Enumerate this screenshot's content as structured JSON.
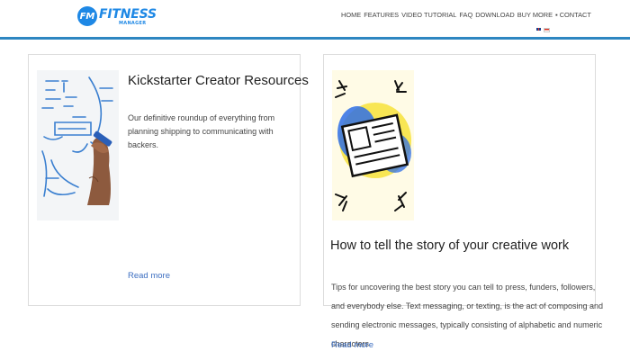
{
  "brand": {
    "badge": "FM",
    "name": "FITNESS",
    "tagline": "MANAGER",
    "color": "#1e88e5"
  },
  "nav": {
    "items": [
      "HOME",
      "FEATURES",
      "VIDEO TUTORIAL",
      "FAQ",
      "DOWNLOAD",
      "BUY MORE",
      "▪ CONTACT"
    ]
  },
  "languages": [
    "uk-flag-icon",
    "indonesia-flag-icon"
  ],
  "cards": [
    {
      "title": "Kickstarter Creator Resources",
      "description": "Our definitive roundup of everything from planning shipping to communicating with backers.",
      "link": "Read more",
      "image": "whiteboard-drawing-image"
    },
    {
      "title": "How to tell the story of your creative work",
      "description": "Tips for uncovering the best story you can tell to press, funders, followers, and everybody else. Text messaging, or texting, is the act of composing and sending electronic messages, typically consisting of alphabetic and numeric characters",
      "link": "Read more",
      "image": "newspaper-illustration-image"
    }
  ],
  "colors": {
    "accent": "#2e86c1",
    "link": "#3d6fc1",
    "border": "#dcdcdc"
  }
}
